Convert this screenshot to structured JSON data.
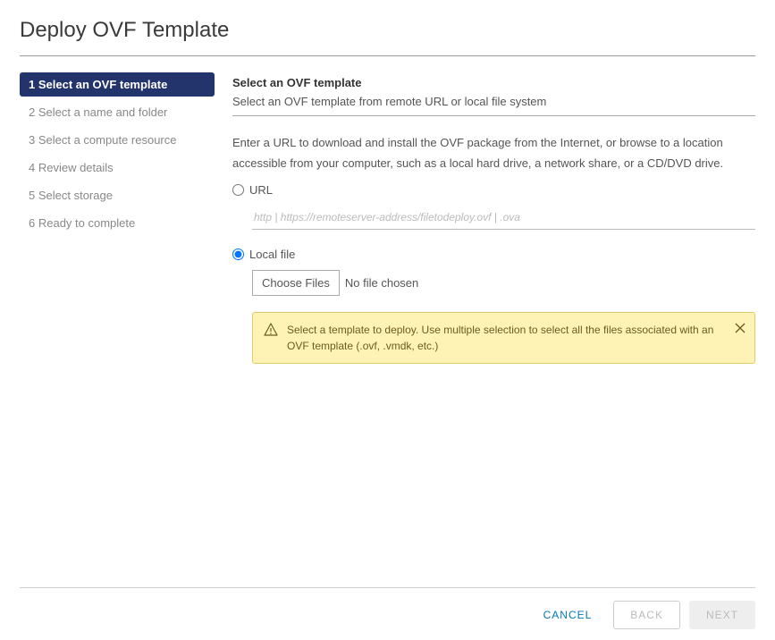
{
  "dialog": {
    "title": "Deploy OVF Template"
  },
  "wizard": {
    "steps": [
      {
        "label": "1 Select an OVF template",
        "active": true
      },
      {
        "label": "2 Select a name and folder",
        "active": false
      },
      {
        "label": "3 Select a compute resource",
        "active": false
      },
      {
        "label": "4 Review details",
        "active": false
      },
      {
        "label": "5 Select storage",
        "active": false
      },
      {
        "label": "6 Ready to complete",
        "active": false
      }
    ]
  },
  "panel": {
    "heading": "Select an OVF template",
    "subheading": "Select an OVF template from remote URL or local file system",
    "help": "Enter a URL to download and install the OVF package from the Internet, or browse to a location accessible from your computer, such as a local hard drive, a network share, or a CD/DVD drive.",
    "url_label": "URL",
    "url_placeholder": "http | https://remoteserver-address/filetodeploy.ovf | .ova",
    "local_label": "Local file",
    "choose_files": "Choose Files",
    "no_file": "No file chosen",
    "alert": "Select a template to deploy. Use multiple selection to select all the files associated with an OVF template (.ovf, .vmdk, etc.)"
  },
  "footer": {
    "cancel": "CANCEL",
    "back": "BACK",
    "next": "NEXT"
  }
}
